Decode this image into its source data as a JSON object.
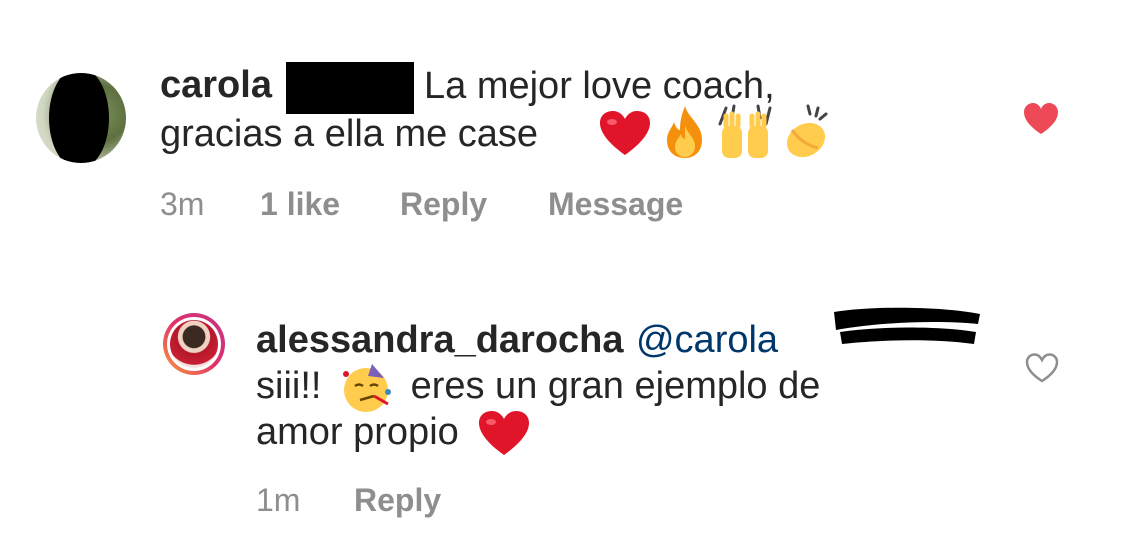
{
  "comment1": {
    "username": "carola",
    "text_line1": "La mejor love coach,",
    "text_line2": "gracias a ella me case",
    "time": "3m",
    "likes": "1 like",
    "reply_label": "Reply",
    "message_label": "Message",
    "liked": true,
    "like_color": "#ed4956",
    "emojis": [
      "red-heart",
      "fire",
      "raising-hands",
      "clapping-hands"
    ]
  },
  "comment2": {
    "username": "alessandra_darocha",
    "mention": "@carola",
    "text_line1": "siii!!",
    "text_line1_rest": "eres un gran ejemplo de",
    "text_line2": "amor propio",
    "time": "1m",
    "reply_label": "Reply",
    "liked": false,
    "emojis": [
      "partying-face",
      "red-heart"
    ]
  }
}
